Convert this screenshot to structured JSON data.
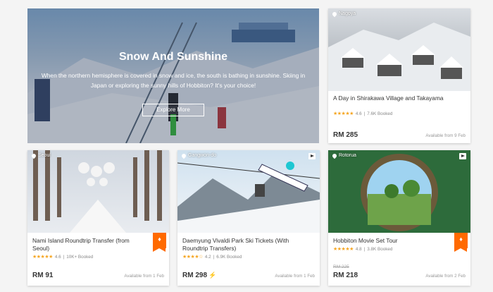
{
  "hero": {
    "title": "Snow And Sunshine",
    "subtitle": "When the northern hemisphere is covered in snow and ice, the south is bathing in sunshine. Skiing in Japan or exploring the sunny hills of Hobbiton? It's your choice!",
    "button": "Explore More"
  },
  "cards": [
    {
      "location": "Nagoya",
      "title": "A Day in Shirakawa Village and Takayama",
      "stars": "★★★★★",
      "rating": "4.6",
      "booked": "7.6K Booked",
      "price": "RM 285",
      "available": "Available from 9 Feb"
    },
    {
      "location": "Seoul",
      "title": "Nami Island Roundtrip Transfer (from Seoul)",
      "stars": "★★★★★",
      "rating": "4.6",
      "booked": "10K+ Booked",
      "price": "RM 91",
      "available": "Available from 1 Feb"
    },
    {
      "location": "Gangwon-do",
      "title": "Daemyung Vivaldi Park Ski Tickets (With Roundtrip Transfers)",
      "stars": "★★★★☆",
      "rating": "4.2",
      "booked": "6.9K Booked",
      "price": "RM 298",
      "available": "Available from 1 Feb"
    },
    {
      "location": "Rotorua",
      "title": "Hobbiton Movie Set Tour",
      "stars": "★★★★★",
      "rating": "4.8",
      "booked": "3.8K Booked",
      "old_price": "RM 225",
      "price": "RM 218",
      "available": "Available from 2 Feb"
    }
  ],
  "separator": "|",
  "colors": {
    "accent": "#ff6a00",
    "star": "#f5a623"
  }
}
